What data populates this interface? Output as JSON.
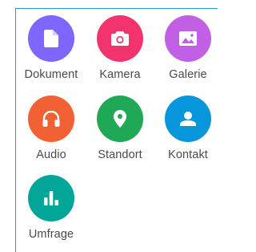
{
  "attachments": {
    "items": [
      {
        "label": "Dokument",
        "icon": "document-icon",
        "color": "#7f66ff"
      },
      {
        "label": "Kamera",
        "icon": "camera-icon",
        "color": "#f2336d"
      },
      {
        "label": "Galerie",
        "icon": "gallery-icon",
        "color": "#c160e5"
      },
      {
        "label": "Audio",
        "icon": "headphones-icon",
        "color": "#f26134"
      },
      {
        "label": "Standort",
        "icon": "location-pin-icon",
        "color": "#1fa855"
      },
      {
        "label": "Kontakt",
        "icon": "contact-icon",
        "color": "#0795dc"
      },
      {
        "label": "Umfrage",
        "icon": "poll-icon",
        "color": "#02a698"
      }
    ]
  }
}
